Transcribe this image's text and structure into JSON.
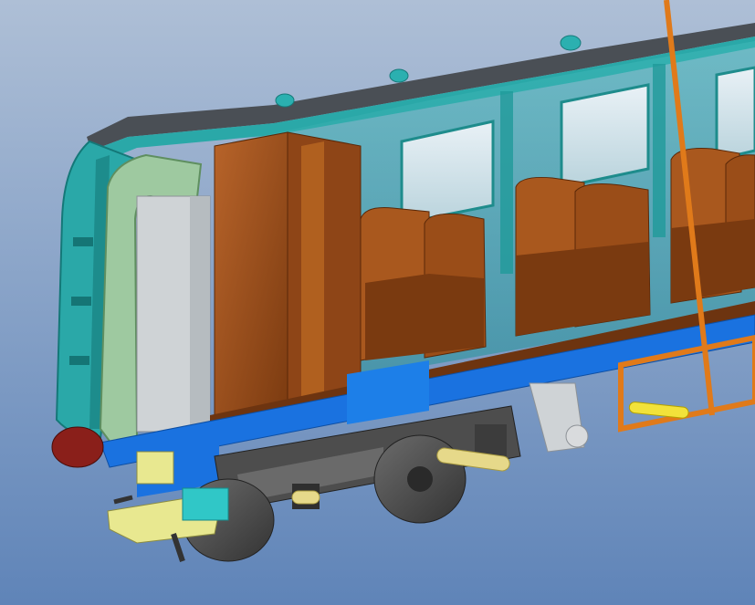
{
  "scene": {
    "subject": "cutaway-railway-coach-model",
    "colors": {
      "background_top": "#aebfd6",
      "background_bottom": "#5f84b8",
      "body_shell": "#2aa8a8",
      "roof": "#4a4f55",
      "interior": "#a0521c",
      "frame": "#1a72e0",
      "cab_door": "#9ec9a0",
      "buffer": "#8a1f1a",
      "bogie": "#4d4d4d",
      "coupler": "#e8e890",
      "axle_pin": "#e6d98a"
    },
    "icons": [
      "roof-vent-icon"
    ]
  }
}
